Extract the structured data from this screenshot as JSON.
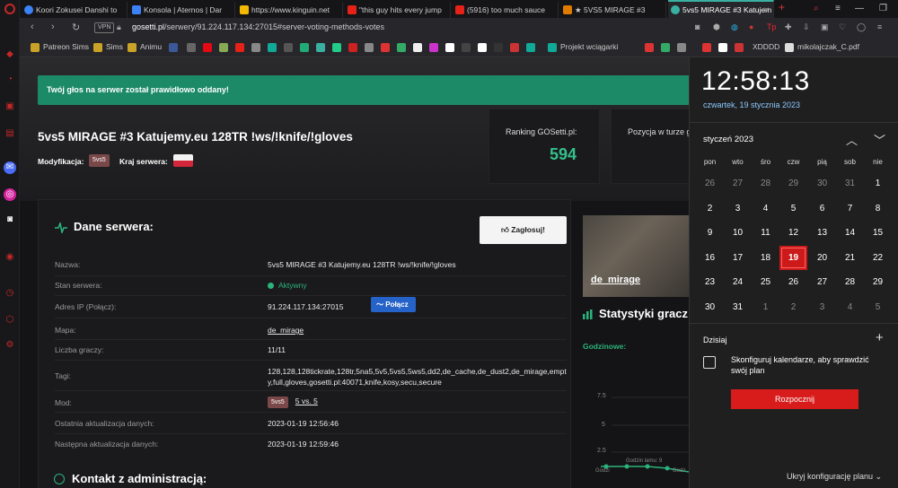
{
  "browser": {
    "tabs": [
      {
        "title": "Koori Zokusei Danshi to",
        "color": "#3b82f6"
      },
      {
        "title": "Konsola | Aternos | Dar",
        "color": "#3b82f6"
      },
      {
        "title": "https://www.kinguin.net",
        "color": "#f5b800"
      },
      {
        "title": "\"this guy hits every jump",
        "color": "#e62117"
      },
      {
        "title": "(5916) too much sauce",
        "color": "#e62117"
      },
      {
        "title": "★ 5VS5 MIRAGE #3",
        "color": "#e07b00"
      },
      {
        "title": "5vs5 MIRAGE #3 Katujem",
        "color": "#3ab0a0"
      }
    ],
    "url_host": "gosetti.pl",
    "url_path": "/serwery/91.224.117.134:27015#server-voting-methods-votes",
    "vpn": "VPN",
    "bookmarks": [
      "Patreon Sims",
      "Sims",
      "Animu",
      "Projekt wciągarki",
      "XDDDD",
      "mikolajczak_C.pdf"
    ]
  },
  "page": {
    "alert": "Twój głos na serwer został prawidłowo oddany!",
    "server_title": "5vs5 MIRAGE #3 Katujemy.eu 128TR !ws/!knife/!gloves",
    "mod_label": "Modyfikacja:",
    "mod_badge": "5vs5",
    "country_label": "Kraj serwera:",
    "ranking_label": "Ranking GOSetti.pl:",
    "ranking_value": "594",
    "position_label": "Pozycja w turze g",
    "card_title": "Dane serwera:",
    "vote_button": "Zagłosuj!",
    "rows": {
      "name_label": "Nazwa:",
      "name_value": "5vs5 MIRAGE #3 Katujemy.eu 128TR !ws/!knife/!gloves",
      "status_label": "Stan serwera:",
      "status_value": "Aktywny",
      "ip_label": "Adres IP (Połącz):",
      "ip_value": "91.224.117.134:27015",
      "connect_button": "Połącz",
      "map_label": "Mapa:",
      "map_value": "de_mirage",
      "players_label": "Liczba graczy:",
      "players_value": "11/11",
      "tags_label": "Tagi:",
      "tags_value": "128,128,128tickrate,128tr,5na5,5v5,5vs5,5ws5,dd2,de_cache,de_dust2,de_mirage,empty,full,gloves,gosetti.pl:40071,knife,kosy,secu,secure",
      "mod_label": "Mod:",
      "mod_badge": "5vs5",
      "mod_value": "5 vs. 5",
      "last_update_label": "Ostatnia aktualizacja danych:",
      "last_update_value": "2023-01-19 12:56:46",
      "next_update_label": "Następna aktualizacja danych:",
      "next_update_value": "2023-01-19 12:59:46"
    },
    "contact_title": "Kontakt z administracją:",
    "map_card_name": "de_mirage",
    "stats_title": "Statystyki gracz",
    "hourly_label": "Godzinowe:",
    "chart_ticks": [
      "7.5",
      "5",
      "2.5"
    ],
    "chart_xlabels": [
      "Godzi",
      "Godzin lamu: 9",
      "Godz"
    ]
  },
  "calendar": {
    "time": "12:58:13",
    "date": "czwartek, 19 stycznia 2023",
    "month": "styczeń 2023",
    "weekdays": [
      "pon",
      "wto",
      "śro",
      "czw",
      "pią",
      "sob",
      "nie"
    ],
    "days": [
      [
        "26",
        "27",
        "28",
        "29",
        "30",
        "31",
        "1"
      ],
      [
        "2",
        "3",
        "4",
        "5",
        "6",
        "7",
        "8"
      ],
      [
        "9",
        "10",
        "11",
        "12",
        "13",
        "14",
        "15"
      ],
      [
        "16",
        "17",
        "18",
        "19",
        "20",
        "21",
        "22"
      ],
      [
        "23",
        "24",
        "25",
        "26",
        "27",
        "28",
        "29"
      ],
      [
        "30",
        "31",
        "1",
        "2",
        "3",
        "4",
        "5"
      ]
    ],
    "today_label": "Dzisiaj",
    "config_text": "Skonfiguruj kalendarze, aby sprawdzić swój plan",
    "start_button": "Rozpocznij",
    "hide_plan": "Ukryj konfigurację planu"
  },
  "colors": {
    "accent_green": "#2bb37c",
    "alert_green": "#1d8a67",
    "today_red": "#cc1a1a",
    "connect_blue": "#2563c9"
  }
}
